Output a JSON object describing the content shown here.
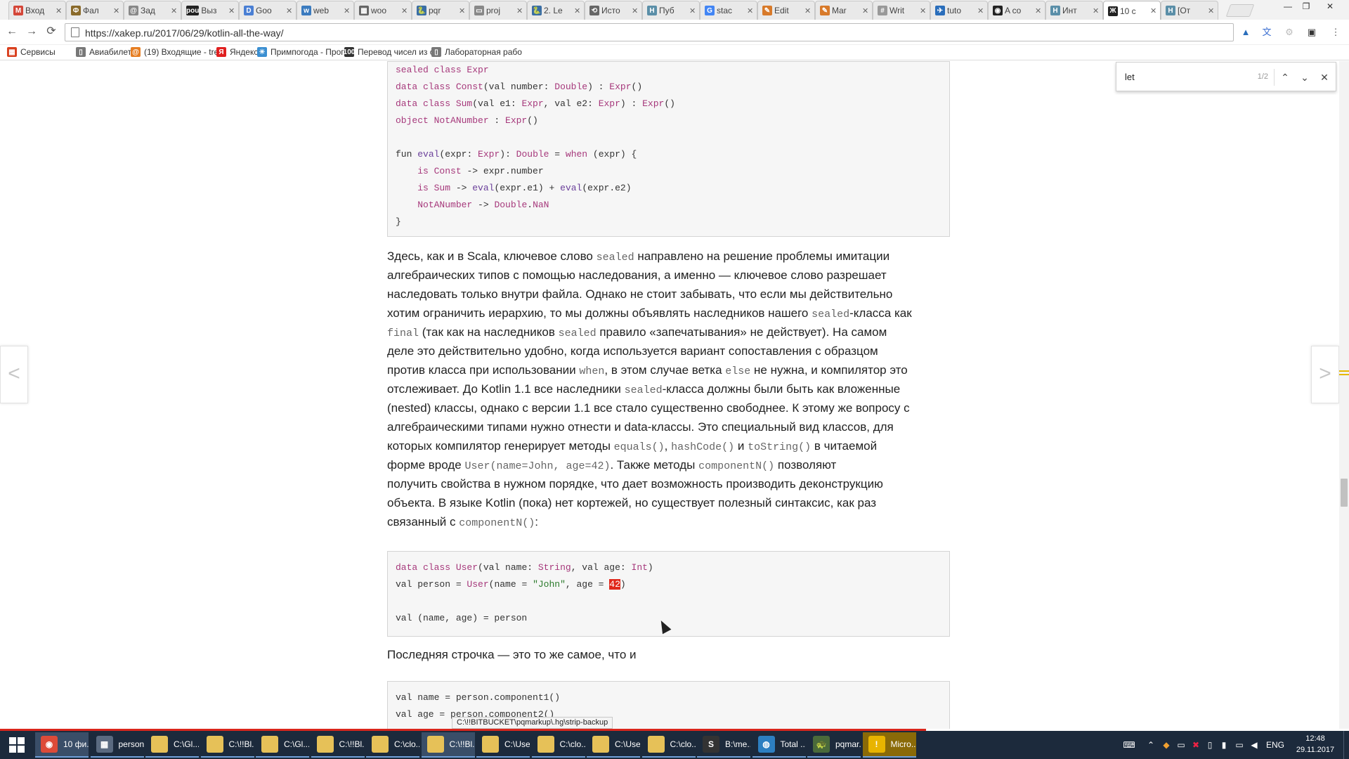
{
  "browser": {
    "tabs": [
      {
        "label": "Вход",
        "fav": "M",
        "color": "#d44638",
        "active": false
      },
      {
        "label": "Фал",
        "fav": "Ф",
        "color": "#8a6a2a",
        "active": false
      },
      {
        "label": "Зад",
        "fav": "@",
        "color": "#888888",
        "active": false
      },
      {
        "label": "Выз",
        "fav": "pou",
        "color": "#222222",
        "active": false
      },
      {
        "label": "Goo",
        "fav": "D",
        "color": "#4a7fd4",
        "active": false
      },
      {
        "label": "web",
        "fav": "w",
        "color": "#3b7bbf",
        "active": false
      },
      {
        "label": "woo",
        "fav": "▦",
        "color": "#666666",
        "active": false
      },
      {
        "label": "pqr",
        "fav": "🐍",
        "color": "#3a6ea5",
        "active": false
      },
      {
        "label": "proj",
        "fav": "▭",
        "color": "#888888",
        "active": false
      },
      {
        "label": "2. Le",
        "fav": "🐍",
        "color": "#3a6ea5",
        "active": false
      },
      {
        "label": "Исто",
        "fav": "⟲",
        "color": "#666666",
        "active": false
      },
      {
        "label": "Пуб",
        "fav": "H",
        "color": "#5b8fa8",
        "active": false
      },
      {
        "label": "stac",
        "fav": "G",
        "color": "#4285f4",
        "active": false
      },
      {
        "label": "Edit",
        "fav": "✎",
        "color": "#d87a2a",
        "active": false
      },
      {
        "label": "Mar",
        "fav": "✎",
        "color": "#d87a2a",
        "active": false
      },
      {
        "label": "Writ",
        "fav": "#",
        "color": "#999999",
        "active": false
      },
      {
        "label": "tuto",
        "fav": "✈",
        "color": "#2a6ebb",
        "active": false
      },
      {
        "label": "A co",
        "fav": "◉",
        "color": "#222222",
        "active": false
      },
      {
        "label": "Инт",
        "fav": "H",
        "color": "#5b8fa8",
        "active": false
      },
      {
        "label": "10 с",
        "fav": "Ж",
        "color": "#222222",
        "active": true
      },
      {
        "label": "[От",
        "fav": "H",
        "color": "#5b8fa8",
        "active": false
      }
    ],
    "url": "https://xakep.ru/2017/06/29/kotlin-all-the-way/",
    "bookmarks": [
      {
        "label": "Сервисы",
        "icon": "▦",
        "color": "#d9401f"
      },
      {
        "label": "Авиабилеты",
        "icon": "▯",
        "color": "#777777"
      },
      {
        "label": "(19) Входящие - tretl",
        "icon": "@",
        "color": "#e67e22"
      },
      {
        "label": "Яндекс",
        "icon": "Я",
        "color": "#e02020"
      },
      {
        "label": "Примпогода - Прогн",
        "icon": "☀",
        "color": "#3b8fd1"
      },
      {
        "label": "Перевод чисел из сі",
        "icon": "100",
        "color": "#333333"
      },
      {
        "label": "Лабораторная рабо",
        "icon": "▯",
        "color": "#777777"
      }
    ]
  },
  "find": {
    "query": "let",
    "count": "1/2"
  },
  "nav": {
    "prev": "<",
    "next": ">"
  },
  "code1": [
    [
      {
        "t": "sealed class ",
        "c": "kw"
      },
      {
        "t": "Expr",
        "c": "ty"
      }
    ],
    [
      {
        "t": "data class ",
        "c": "kw"
      },
      {
        "t": "Const",
        "c": "ty"
      },
      {
        "t": "(val number: ",
        "c": ""
      },
      {
        "t": "Double",
        "c": "ty"
      },
      {
        "t": ") : ",
        "c": ""
      },
      {
        "t": "Expr",
        "c": "ty"
      },
      {
        "t": "()",
        "c": ""
      }
    ],
    [
      {
        "t": "data class ",
        "c": "kw"
      },
      {
        "t": "Sum",
        "c": "ty"
      },
      {
        "t": "(val e1: ",
        "c": ""
      },
      {
        "t": "Expr",
        "c": "ty"
      },
      {
        "t": ", val e2: ",
        "c": ""
      },
      {
        "t": "Expr",
        "c": "ty"
      },
      {
        "t": ") : ",
        "c": ""
      },
      {
        "t": "Expr",
        "c": "ty"
      },
      {
        "t": "()",
        "c": ""
      }
    ],
    [
      {
        "t": "object ",
        "c": "kw"
      },
      {
        "t": "NotANumber",
        "c": "ty"
      },
      {
        "t": " : ",
        "c": ""
      },
      {
        "t": "Expr",
        "c": "ty"
      },
      {
        "t": "()",
        "c": ""
      }
    ],
    [],
    [
      {
        "t": "fun ",
        "c": ""
      },
      {
        "t": "eval",
        "c": "fn"
      },
      {
        "t": "(expr: ",
        "c": ""
      },
      {
        "t": "Expr",
        "c": "ty"
      },
      {
        "t": "): ",
        "c": ""
      },
      {
        "t": "Double",
        "c": "ty"
      },
      {
        "t": " = ",
        "c": ""
      },
      {
        "t": "when",
        "c": "kw"
      },
      {
        "t": " (expr) {",
        "c": ""
      }
    ],
    [
      {
        "t": "    ",
        "c": ""
      },
      {
        "t": "is ",
        "c": "kw"
      },
      {
        "t": "Const",
        "c": "ty"
      },
      {
        "t": " -> expr.number",
        "c": ""
      }
    ],
    [
      {
        "t": "    ",
        "c": ""
      },
      {
        "t": "is ",
        "c": "kw"
      },
      {
        "t": "Sum",
        "c": "ty"
      },
      {
        "t": " -> ",
        "c": ""
      },
      {
        "t": "eval",
        "c": "fn"
      },
      {
        "t": "(expr.e1) + ",
        "c": ""
      },
      {
        "t": "eval",
        "c": "fn"
      },
      {
        "t": "(expr.e2)",
        "c": ""
      }
    ],
    [
      {
        "t": "    ",
        "c": ""
      },
      {
        "t": "NotANumber",
        "c": "ty"
      },
      {
        "t": " -> ",
        "c": ""
      },
      {
        "t": "Double",
        "c": "ty"
      },
      {
        "t": ".",
        "c": ""
      },
      {
        "t": "NaN",
        "c": "ty"
      }
    ],
    [
      {
        "t": "}",
        "c": ""
      }
    ]
  ],
  "paragraph1": [
    [
      {
        "t": "Здесь, как и в Scala, ключевое слово "
      },
      {
        "t": "sealed",
        "code": true
      },
      {
        "t": " направлено на решение проблемы имитации"
      }
    ],
    [
      {
        "t": "алгебраических типов с помощью наследования, а именно — ключевое слово разрешает"
      }
    ],
    [
      {
        "t": "наследовать только внутри файла. Однако не стоит забывать, что если мы действительно"
      }
    ],
    [
      {
        "t": "хотим ограничить иерархию, то мы должны объявлять наследников нашего "
      },
      {
        "t": "sealed",
        "code": true
      },
      {
        "t": "-класса как"
      }
    ],
    [
      {
        "t": "final",
        "code": true
      },
      {
        "t": " (так как на наследников "
      },
      {
        "t": "sealed",
        "code": true
      },
      {
        "t": " правило «запечатывания» не действует). На самом"
      }
    ],
    [
      {
        "t": "деле это действительно удобно, когда используется вариант сопоставления с образцом"
      }
    ],
    [
      {
        "t": "против класса при использовании "
      },
      {
        "t": "when",
        "code": true
      },
      {
        "t": ", в этом случае ветка "
      },
      {
        "t": "else",
        "code": true
      },
      {
        "t": " не нужна, и компилятор это"
      }
    ],
    [
      {
        "t": "отслеживает. До Kotlin 1.1 все наследники "
      },
      {
        "t": "sealed",
        "code": true
      },
      {
        "t": "-класса должны были быть как вложенные"
      }
    ],
    [
      {
        "t": "(nested) классы, однако с версии 1.1 все стало существенно свободнее. К этому же вопросу с"
      }
    ],
    [
      {
        "t": "алгебраическими типами нужно отнести и data-классы. Это специальный вид классов, для"
      }
    ],
    [
      {
        "t": "которых компилятор генерирует методы "
      },
      {
        "t": "equals()",
        "code": true
      },
      {
        "t": ", "
      },
      {
        "t": "hashCode()",
        "code": true
      },
      {
        "t": " и "
      },
      {
        "t": "toString()",
        "code": true
      },
      {
        "t": " в читаемой"
      }
    ],
    [
      {
        "t": "форме вроде "
      },
      {
        "t": "User(name=John, age=42)",
        "code": true
      },
      {
        "t": ". Также методы "
      },
      {
        "t": "componentN()",
        "code": true
      },
      {
        "t": " позволяют"
      }
    ],
    [
      {
        "t": "получить свойства в нужном порядке, что дает возможность производить деконструкцию"
      }
    ],
    [
      {
        "t": "объекта. В языке Kotlin (пока) нет кортежей, но существует полезный синтаксис, как раз"
      }
    ],
    [
      {
        "t": "связанный с "
      },
      {
        "t": "componentN()",
        "code": true
      },
      {
        "t": ":"
      }
    ]
  ],
  "code2": [
    [
      {
        "t": "data class ",
        "c": "kw"
      },
      {
        "t": "User",
        "c": "ty"
      },
      {
        "t": "(val name: ",
        "c": ""
      },
      {
        "t": "String",
        "c": "ty"
      },
      {
        "t": ", val age: ",
        "c": ""
      },
      {
        "t": "Int",
        "c": "ty"
      },
      {
        "t": ")",
        "c": ""
      }
    ],
    [
      {
        "t": "val person = ",
        "c": ""
      },
      {
        "t": "User",
        "c": "ty"
      },
      {
        "t": "(name = ",
        "c": ""
      },
      {
        "t": "\"John\"",
        "c": "str"
      },
      {
        "t": ", age = ",
        "c": ""
      },
      {
        "t": "42",
        "c": "mark42"
      },
      {
        "t": ")",
        "c": ""
      }
    ],
    [],
    [
      {
        "t": "val (name, age) = person",
        "c": ""
      }
    ]
  ],
  "paragraph2": "Последняя строчка — это то же самое, что и",
  "code3": [
    [
      {
        "t": "val name = person.component1()",
        "c": ""
      }
    ],
    [
      {
        "t": "val age = person.component2()",
        "c": ""
      }
    ]
  ],
  "status_tooltip": "C:\\!!BITBUCKET\\pqmarkup\\.hg\\strip-backup",
  "taskbar": {
    "items": [
      {
        "label": "10 фи...",
        "icon": "chrome",
        "active": true
      },
      {
        "label": "person...",
        "icon": "app",
        "active": false
      },
      {
        "label": "C:\\Gl...",
        "icon": "folder",
        "active": false
      },
      {
        "label": "C:\\!!Bl...",
        "icon": "folder",
        "active": false
      },
      {
        "label": "C:\\Gl...",
        "icon": "folder",
        "active": false
      },
      {
        "label": "C:\\!!Bl...",
        "icon": "folder",
        "active": false
      },
      {
        "label": "C:\\clo...",
        "icon": "folder",
        "active": false
      },
      {
        "label": "C:\\!!Bl...",
        "icon": "folder",
        "active": true
      },
      {
        "label": "C:\\Use...",
        "icon": "folder",
        "active": false
      },
      {
        "label": "C:\\clo...",
        "icon": "folder",
        "active": false
      },
      {
        "label": "C:\\Use...",
        "icon": "folder",
        "active": false
      },
      {
        "label": "C:\\clo...",
        "icon": "folder",
        "active": false
      },
      {
        "label": "B:\\me...",
        "icon": "sublime",
        "active": false
      },
      {
        "label": "Total ...",
        "icon": "globe",
        "active": false
      },
      {
        "label": "pqmar...",
        "icon": "turtle",
        "active": false
      },
      {
        "label": "Micro...",
        "icon": "warning",
        "active": false
      }
    ],
    "lang": "ENG",
    "time": "12:48",
    "date": "29.11.2017"
  }
}
